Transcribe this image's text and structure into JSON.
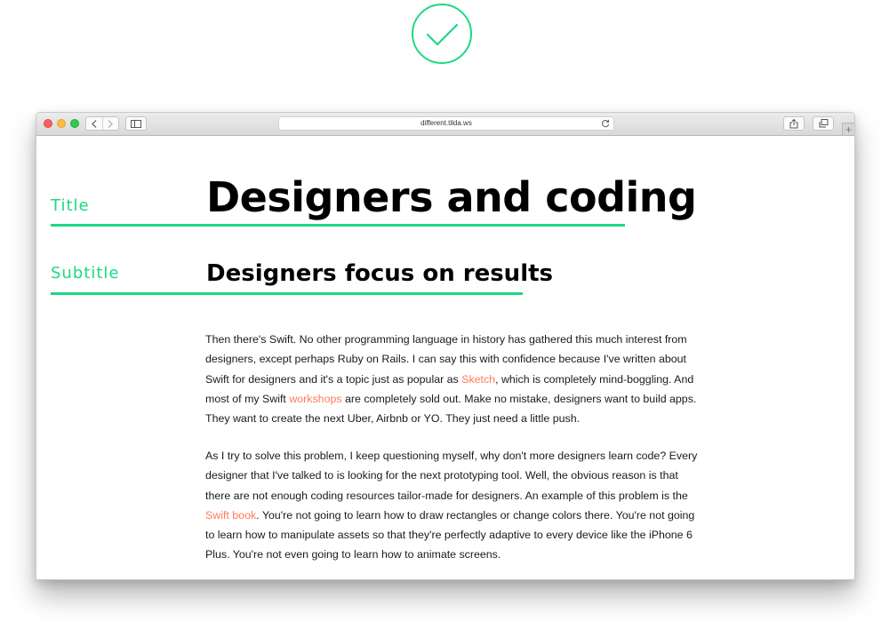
{
  "colors": {
    "accent_green": "#1ed884",
    "link_orange": "#ff7a58"
  },
  "icons": {
    "top": "checkmark-circle-icon",
    "toolbar": [
      "back-chevron-icon",
      "forward-chevron-icon",
      "sidebar-icon",
      "reload-icon",
      "share-icon",
      "tabs-overview-icon",
      "plus-icon"
    ]
  },
  "browser": {
    "url": "different.tilda.ws",
    "new_tab": "+"
  },
  "page": {
    "title_label": "Title",
    "subtitle_label": "Subtitle",
    "heading": "Designers and coding",
    "subheading": "Designers focus on results"
  },
  "paragraph1": {
    "t1": "Then there's Swift. No other programming language in history has gathered this much interest from designers, except perhaps Ruby on Rails. I can say this with confidence because I've written about Swift for designers and it's a topic just as popular as ",
    "link1": "Sketch",
    "t2": ", which is completely mind-boggling. And most of my Swift ",
    "link2": "workshops",
    "t3": " are completely sold out. Make no mistake, designers want to build apps. They want to create the next Uber, Airbnb or YO. They just need a little push."
  },
  "paragraph2": {
    "t1": "As I try to solve this problem, I keep questioning myself, why don't more designers learn code? Every designer that I've talked to is looking for the next prototyping tool. Well, the obvious reason is that there are not enough coding resources tailor-made for designers. An example of this problem is the ",
    "link1": "Swift book",
    "t2": ". You're not going to learn how to draw rectangles or change colors there. You're not going to learn how to manipulate assets so that they're perfectly adaptive to every device like the iPhone 6 Plus. You're not even going to learn how to animate screens."
  }
}
